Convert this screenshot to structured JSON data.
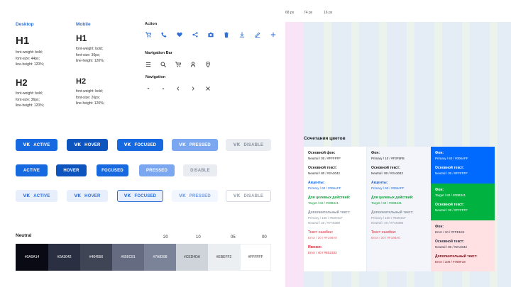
{
  "typography": {
    "desktop": {
      "header": "Desktop",
      "h1": "H1",
      "h1_spec": "font-weight: bold;\nfont-size: 44px;\nline-height: 120%;",
      "h2": "H2",
      "h2_spec": "font-weight: bold;\nfont-size: 36px;\nline-height: 120%;"
    },
    "mobile": {
      "header": "Mobile",
      "h1": "H1",
      "h1_spec": "font-weight: bold;\nfont-size: 30px;\nline-height: 120%;",
      "h2": "H2",
      "h2_spec": "font-weight: bold;\nfont-size: 26px;\nline-height: 120%;"
    }
  },
  "icons": {
    "action_label": "Action",
    "action": [
      "cart-icon",
      "phone-icon",
      "heart-icon",
      "share-icon",
      "camera-icon",
      "trash-icon",
      "download-icon",
      "edit-icon",
      "plus-icon"
    ],
    "nav_bar_label": "Navigation Bar",
    "nav_bar": [
      "menu-icon",
      "search-icon",
      "cart-icon",
      "user-icon",
      "location-icon"
    ],
    "navigation_label": "Navigation",
    "navigation": [
      "caret-down-icon",
      "caret-up-icon",
      "chevron-left-icon",
      "chevron-right-icon",
      "close-icon"
    ],
    "accent_color": "#2f6fd6"
  },
  "buttons": {
    "vk": "VK",
    "row1": [
      "ACTIVE",
      "HOVER",
      "FOCUSED",
      "PRESSED",
      "DISABLE"
    ],
    "row2": [
      "ACTIVE",
      "HOVER",
      "FOCUSED",
      "PRESSED",
      "DISABLE"
    ],
    "row3": [
      "ACTIVE",
      "HOVER",
      "FOCUSED",
      "PRESSED",
      "DISABLE"
    ]
  },
  "neutral": {
    "title": "Neutral",
    "ticks": [
      "20",
      "10",
      "05",
      "00"
    ],
    "swatches": [
      {
        "hex": "#0A0A14",
        "color": "#0A0A14",
        "text": "#ffffff"
      },
      {
        "hex": "#2A3042",
        "color": "#2A3042",
        "text": "#ffffff"
      },
      {
        "hex": "#404556",
        "color": "#404556",
        "text": "#ffffff"
      },
      {
        "hex": "#656C81",
        "color": "#656C81",
        "text": "#ffffff"
      },
      {
        "hex": "#7A8398",
        "color": "#7A8398",
        "text": "#ffffff"
      },
      {
        "hex": "#CED4DA",
        "color": "#CED4DA",
        "text": "#333333"
      },
      {
        "hex": "#EBEFF2",
        "color": "#EBEFF2",
        "text": "#333333"
      },
      {
        "hex": "#FFFFFF",
        "color": "#FFFFFF",
        "text": "#333333"
      }
    ]
  },
  "grid": {
    "labels": [
      "68 px",
      "74 px",
      "16 px"
    ]
  },
  "combinations": {
    "title": "Сочетания цветов",
    "col1": [
      {
        "label": "Основной фон:",
        "value": "Neutral / 00 / #FFFFFF",
        "color": "#222222"
      },
      {
        "label": "Основной текст:",
        "value": "Neutral / 80 / #2A3042",
        "color": "#222222"
      },
      {
        "label": "Акценты:",
        "value": "Primary / 60 / #006AFF",
        "color": "#1769e0"
      },
      {
        "label": "Для целевых действий:",
        "value": "Target / 60 / #00B341",
        "color": "#12a13c"
      },
      {
        "label": "Дополнительный текст:",
        "value": "Primary / 100 / #9294CF\nNeutral / 20 / #7A8398",
        "color": "#8a93a0"
      },
      {
        "label": "Текст ошибки:",
        "value": "Error / 20 / #F198A0",
        "color": "#e8606c"
      },
      {
        "label": "Иконки:",
        "value": "Error / 40 / #E52333",
        "color": "#e52333"
      }
    ],
    "col2": [
      {
        "label": "Фон:",
        "value": "Primary / 10 / #F3F5FB",
        "color": "#222222"
      },
      {
        "label": "Основной текст:",
        "value": "Neutral / 80 / #2A3042",
        "color": "#222222"
      },
      {
        "label": "Акценты:",
        "value": "Primary / 60 / #006AFF",
        "color": "#1769e0"
      },
      {
        "label": "Для целевых действий:",
        "value": "Target / 60 / #00B341",
        "color": "#12a13c"
      },
      {
        "label": "Дополнительный текст:",
        "value": "Primary / 100 / #9294CF\nNeutral / 20 / #7A8398",
        "color": "#8a93a0"
      },
      {
        "label": "Текст ошибки:",
        "value": "Error / 20 / #F198A0",
        "color": "#e8606c"
      }
    ],
    "blue": [
      {
        "label": "Фон:",
        "value": "Primary / 60 / #006AFF"
      },
      {
        "label": "Основной текст:",
        "value": "Neutral / 00 / #FFFFFF"
      }
    ],
    "green": [
      {
        "label": "Фон:",
        "value": "Target / 60 / #00B341"
      },
      {
        "label": "Основной текст:",
        "value": "Neutral / 00 / #FFFFFF"
      }
    ],
    "pink": [
      {
        "label": "Фон:",
        "value": "Error / 10 / #FFE1E4"
      },
      {
        "label": "Основной текст:",
        "value": "Neutral / 80 / #2A3042"
      },
      {
        "label": "Дополнительный текст:",
        "value": "Error / 100 / #790F19"
      }
    ]
  }
}
